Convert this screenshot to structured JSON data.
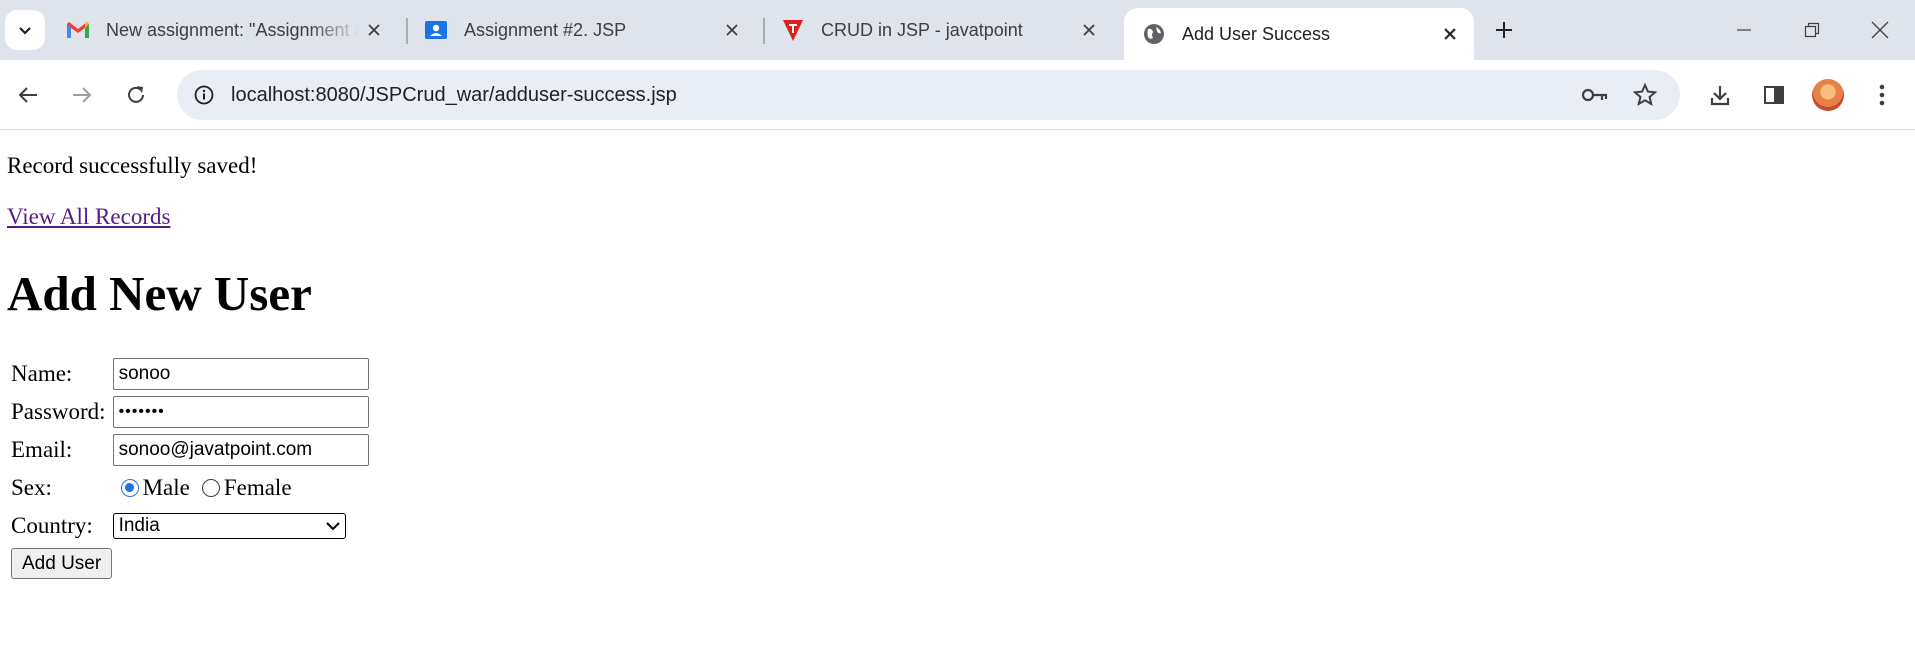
{
  "browser": {
    "tabs": [
      {
        "title": "New assignment: \"Assignment #",
        "favicon": "gmail-icon"
      },
      {
        "title": "Assignment #2. JSP",
        "favicon": "classroom-icon"
      },
      {
        "title": "CRUD in JSP - javatpoint",
        "favicon": "javatpoint-icon"
      },
      {
        "title": "Add User Success",
        "favicon": "globe-icon",
        "active": true
      }
    ],
    "url": "localhost:8080/JSPCrud_war/adduser-success.jsp"
  },
  "page": {
    "message": "Record successfully saved!",
    "view_link": "View All Records",
    "heading": "Add New User",
    "form": {
      "name_label": "Name:",
      "name_value": "sonoo",
      "password_label": "Password:",
      "password_value": "•••••••",
      "email_label": "Email:",
      "email_value": "sonoo@javatpoint.com",
      "sex_label": "Sex:",
      "sex_options": [
        "Male",
        "Female"
      ],
      "sex_selected": "Male",
      "country_label": "Country:",
      "country_value": "India",
      "submit_label": "Add User"
    }
  },
  "colors": {
    "tabstrip": "#dfe3eb",
    "omnibox": "#e9edf5",
    "visited_link": "#551a8b",
    "radio_accent": "#1a73e8"
  }
}
